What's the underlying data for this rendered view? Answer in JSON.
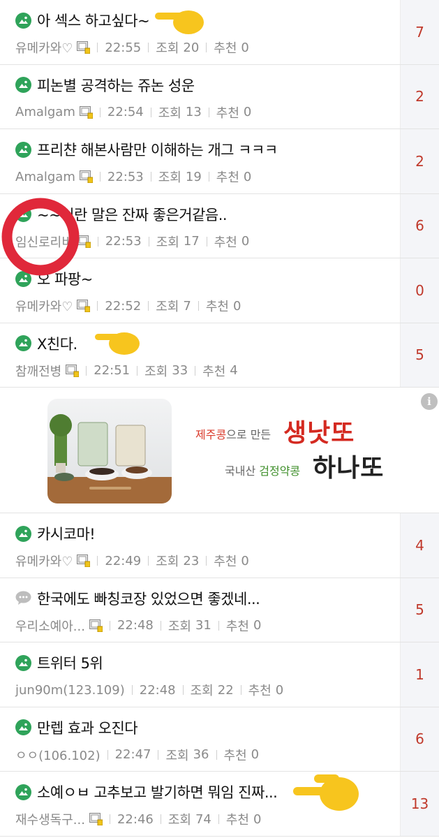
{
  "posts": [
    {
      "icon": "image-icon",
      "title": "아 섹스 하고싶다~",
      "author": "유메카와♡",
      "badge": true,
      "time": "22:55",
      "views_label": "조회",
      "views": "20",
      "recs_label": "추천",
      "recs": "0",
      "comments": "7"
    },
    {
      "icon": "image-icon",
      "title": "피논별 공격하는 쥬논 성운",
      "author": "Amalgam",
      "badge": true,
      "time": "22:54",
      "views_label": "조회",
      "views": "13",
      "recs_label": "추천",
      "recs": "0",
      "comments": "2"
    },
    {
      "icon": "image-icon",
      "title": "프리챤 해본사람만 이해하는 개그 ㅋㅋㅋ",
      "author": "Amalgam",
      "badge": true,
      "time": "22:53",
      "views_label": "조회",
      "views": "19",
      "recs_label": "추천",
      "recs": "0",
      "comments": "2"
    },
    {
      "icon": "image-icon",
      "title": "~~이란 말은 잔짜 좋은거같음..",
      "author": "임신로리비",
      "badge": true,
      "time": "22:53",
      "views_label": "조회",
      "views": "17",
      "recs_label": "추천",
      "recs": "0",
      "comments": "6"
    },
    {
      "icon": "image-icon",
      "title": "오 파팡~",
      "author": "유메카와♡",
      "badge": true,
      "time": "22:52",
      "views_label": "조회",
      "views": "7",
      "recs_label": "추천",
      "recs": "0",
      "comments": "0"
    },
    {
      "icon": "image-icon",
      "title": "X친다.",
      "author": "참깨전병",
      "badge": true,
      "time": "22:51",
      "views_label": "조회",
      "views": "33",
      "recs_label": "추천",
      "recs": "4",
      "comments": "5"
    }
  ],
  "ad": {
    "info_icon": "i",
    "line1_red": "제주콩",
    "line1_rest": "으로 만든",
    "big1": "생낫또",
    "line2_rest": "국내산 ",
    "line2_green": "검정약콩",
    "big2": "하나또"
  },
  "posts2": [
    {
      "icon": "image-icon",
      "title": "카시코마!",
      "author": "유메카와♡",
      "badge": true,
      "time": "22:49",
      "views_label": "조회",
      "views": "23",
      "recs_label": "추천",
      "recs": "0",
      "comments": "4"
    },
    {
      "icon": "chat-icon",
      "title": "한국에도 빠칭코장 있었으면 좋겠네...",
      "author": "우리소예아...",
      "badge": true,
      "time": "22:48",
      "views_label": "조회",
      "views": "31",
      "recs_label": "추천",
      "recs": "0",
      "comments": "5"
    },
    {
      "icon": "image-icon",
      "title": "트위터 5위",
      "author": "jun90m(123.109)",
      "badge": false,
      "time": "22:48",
      "views_label": "조회",
      "views": "22",
      "recs_label": "추천",
      "recs": "0",
      "comments": "1"
    },
    {
      "icon": "image-icon",
      "title": "만렙 효과 오진다",
      "author": "ㅇㅇ(106.102)",
      "badge": false,
      "time": "22:47",
      "views_label": "조회",
      "views": "36",
      "recs_label": "추천",
      "recs": "0",
      "comments": "6"
    },
    {
      "icon": "image-icon",
      "title": "소예ㅇㅂ 고추보고 발기하면 뭐임 진짜...",
      "author": "재수생독구...",
      "badge": true,
      "time": "22:46",
      "views_label": "조회",
      "views": "74",
      "recs_label": "추천",
      "recs": "0",
      "comments": "13"
    }
  ],
  "colors": {
    "comment_count": "#c0392b",
    "icon_green": "#2fa35a",
    "annotation_yellow": "#f7c51e",
    "annotation_red": "#e0283a"
  }
}
